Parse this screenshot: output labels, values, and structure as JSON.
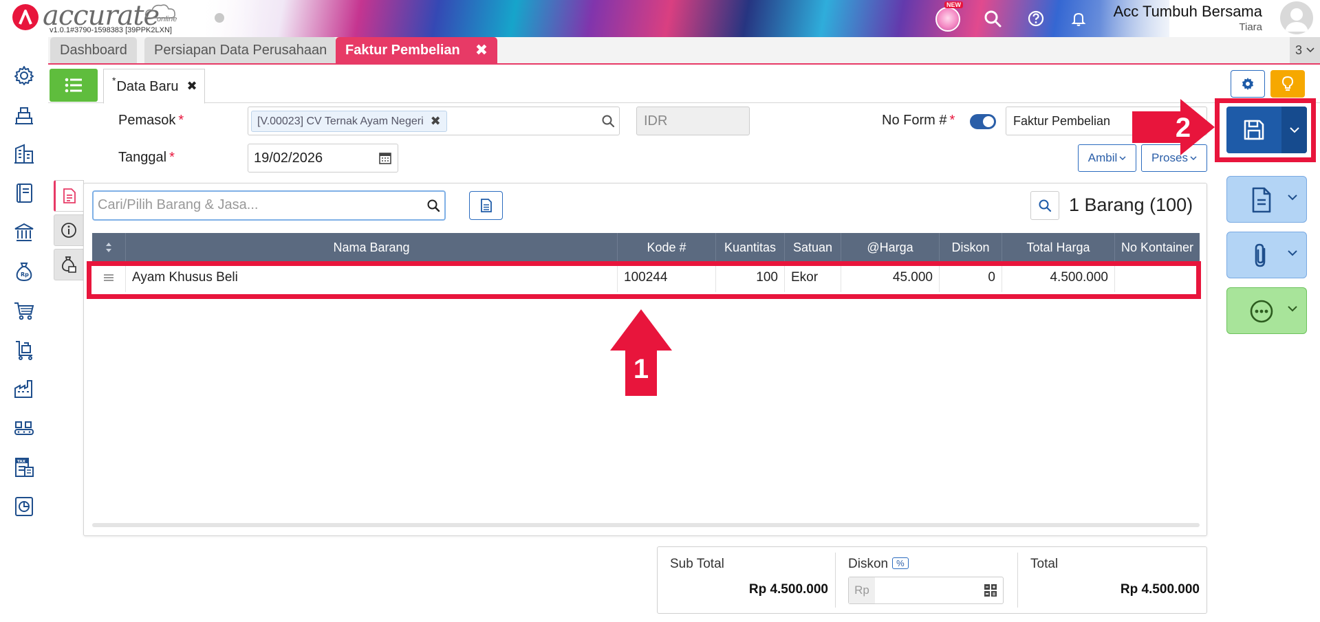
{
  "header": {
    "logo_text": "accurate",
    "logo_sub": "online",
    "version": "v1.0.1#3790-1598383 [39PPK2LXN]",
    "new_badge": "NEW",
    "company_name": "Acc Tumbuh Bersama",
    "user_name": "Tiara"
  },
  "tabs": [
    {
      "label": "Dashboard"
    },
    {
      "label": "Persiapan Data Perusahaan"
    },
    {
      "label": "Faktur Pembelian"
    }
  ],
  "tab_count": "3",
  "subtab": {
    "star": "*",
    "label": "Data Baru"
  },
  "form": {
    "pemasok_label": "Pemasok",
    "pemasok_value": "[V.00023] CV Ternak Ayam Negeri",
    "currency": "IDR",
    "noform_label": "No Form #",
    "noform_value": "Faktur Pembelian",
    "tanggal_label": "Tanggal",
    "tanggal_value": "19/02/2026",
    "required_mark": "*",
    "ambil_label": "Ambil",
    "proses_label": "Proses"
  },
  "items": {
    "search_placeholder": "Cari/Pilih Barang & Jasa...",
    "count_label": "1 Barang (100)",
    "columns": [
      "Nama Barang",
      "Kode #",
      "Kuantitas",
      "Satuan",
      "@Harga",
      "Diskon",
      "Total Harga",
      "No Kontainer"
    ],
    "rows": [
      {
        "nama": "Ayam Khusus Beli",
        "kode": "100244",
        "kuantitas": "100",
        "satuan": "Ekor",
        "harga": "45.000",
        "diskon": "0",
        "total": "4.500.000",
        "kontainer": ""
      }
    ]
  },
  "totals": {
    "subtotal_label": "Sub Total",
    "subtotal_value": "Rp 4.500.000",
    "diskon_label": "Diskon",
    "diskon_pct": "%",
    "diskon_prefix": "Rp",
    "total_label": "Total",
    "total_value": "Rp 4.500.000"
  },
  "annotations": {
    "step1": "1",
    "step2": "2"
  },
  "colors": {
    "accent_pink": "#e73a66",
    "primary_blue": "#1e5ba8",
    "grid_header": "#5b6a80",
    "annotation_red": "#e8153c",
    "list_green": "#5fbd3d",
    "bulb_orange": "#f6a800"
  },
  "icons": [
    "settings-icon",
    "warehouse-icon",
    "company-icon",
    "book-icon",
    "bank-icon",
    "money-bag-icon",
    "cart-icon",
    "trolley-icon",
    "factory-icon",
    "conveyor-icon",
    "tax-icon",
    "report-icon",
    "search-icon",
    "help-icon",
    "bell-icon",
    "save-icon",
    "document-icon",
    "paperclip-icon",
    "more-icon",
    "gear-icon",
    "bulb-icon",
    "calendar-icon",
    "calculator-icon",
    "list-icon",
    "info-icon"
  ]
}
